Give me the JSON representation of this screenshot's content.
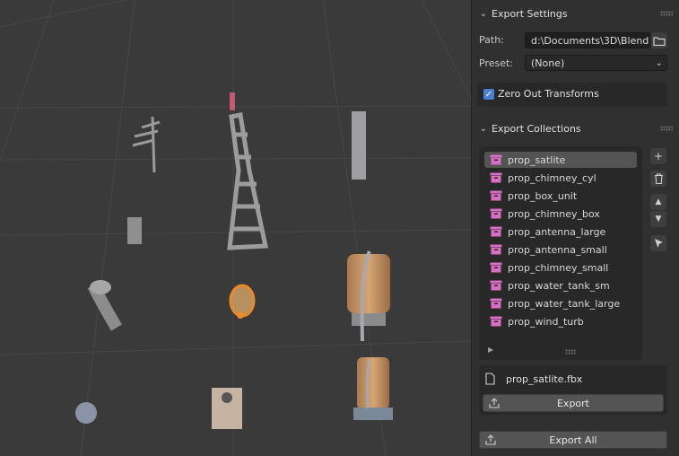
{
  "export_settings": {
    "title": "Export Settings",
    "path_label": "Path:",
    "path_value": "d:\\Documents\\3D\\Blend...",
    "preset_label": "Preset:",
    "preset_value": "(None)",
    "zero_out_label": "Zero Out Transforms",
    "zero_out_checked": true
  },
  "export_collections": {
    "title": "Export Collections",
    "items": [
      {
        "label": "prop_satlite",
        "active": true
      },
      {
        "label": "prop_chimney_cyl"
      },
      {
        "label": "prop_box_unit"
      },
      {
        "label": "prop_chimney_box"
      },
      {
        "label": "prop_antenna_large"
      },
      {
        "label": "prop_antenna_small"
      },
      {
        "label": "prop_chimney_small"
      },
      {
        "label": "prop_water_tank_sm"
      },
      {
        "label": "prop_water_tank_large"
      },
      {
        "label": "prop_wind_turb"
      }
    ],
    "file_name": "prop_satlite.fbx",
    "export_label": "Export",
    "export_all_label": "Export All"
  },
  "colors": {
    "collection_icon": "#d96fc2",
    "accent": "#4a7fd1",
    "selected_outline": "#e8892b"
  }
}
